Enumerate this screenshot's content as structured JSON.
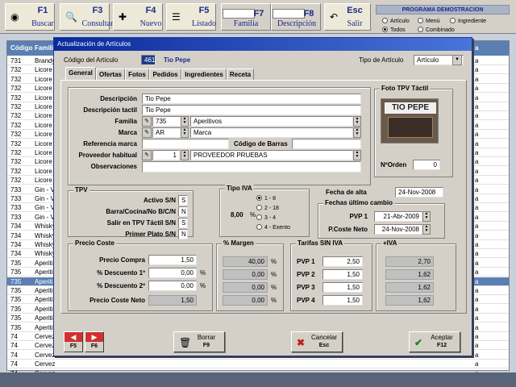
{
  "toolbar": {
    "buttons": [
      {
        "key": "F1",
        "label": "Buscar",
        "icon": "binoculars-icon"
      },
      {
        "key": "F3",
        "label": "Consultar",
        "icon": "magnifier-doc-icon"
      },
      {
        "key": "F4",
        "label": "Nuevo",
        "icon": "new-doc-icon"
      },
      {
        "key": "F5",
        "label": "Listado",
        "icon": "list-icon"
      }
    ],
    "f7": {
      "key": "F7",
      "label": "Familia"
    },
    "f8": {
      "key": "F8",
      "label": "Descripción"
    },
    "esc": {
      "key": "Esc",
      "label": "Salir",
      "icon": "exit-arrow-icon"
    }
  },
  "demo": {
    "title": "PROGRAMA DEMOSTRACION",
    "options": [
      "Artículo",
      "Menú",
      "Ingrediente",
      "Todos",
      "Combinado"
    ],
    "selected": "Todos"
  },
  "grid": {
    "headers": [
      "Código",
      "Familia",
      "a"
    ],
    "rows": [
      {
        "code": "731",
        "fam": "Brandy",
        "end": "a"
      },
      {
        "code": "732",
        "fam": "Licore",
        "end": "a"
      },
      {
        "code": "732",
        "fam": "Licore",
        "end": "a"
      },
      {
        "code": "732",
        "fam": "Licore",
        "end": "a"
      },
      {
        "code": "732",
        "fam": "Licore",
        "end": "a"
      },
      {
        "code": "732",
        "fam": "Licore",
        "end": "a"
      },
      {
        "code": "732",
        "fam": "Licore",
        "end": "a"
      },
      {
        "code": "732",
        "fam": "Licore",
        "end": "a"
      },
      {
        "code": "732",
        "fam": "Licore",
        "end": "a"
      },
      {
        "code": "732",
        "fam": "Licore",
        "end": "a"
      },
      {
        "code": "732",
        "fam": "Licore",
        "end": "a"
      },
      {
        "code": "732",
        "fam": "Licore",
        "end": "a"
      },
      {
        "code": "732",
        "fam": "Licore",
        "end": "a"
      },
      {
        "code": "732",
        "fam": "Licore",
        "end": "a"
      },
      {
        "code": "733",
        "fam": "Gin - V",
        "end": "a"
      },
      {
        "code": "733",
        "fam": "Gin - V",
        "end": "a"
      },
      {
        "code": "733",
        "fam": "Gin - V",
        "end": "a"
      },
      {
        "code": "733",
        "fam": "Gin - V",
        "end": "a"
      },
      {
        "code": "734",
        "fam": "Whisky",
        "end": "a"
      },
      {
        "code": "734",
        "fam": "Whisky",
        "end": "a"
      },
      {
        "code": "734",
        "fam": "Whisky",
        "end": "a"
      },
      {
        "code": "734",
        "fam": "Whisky",
        "end": "a"
      },
      {
        "code": "735",
        "fam": "Aperiti",
        "end": "a"
      },
      {
        "code": "735",
        "fam": "Aperiti",
        "end": "a"
      },
      {
        "code": "735",
        "fam": "Aperiti",
        "end": "a"
      },
      {
        "code": "735",
        "fam": "Aperiti",
        "end": "a"
      },
      {
        "code": "735",
        "fam": "Aperiti",
        "end": "a"
      },
      {
        "code": "735",
        "fam": "Aperiti",
        "end": "a"
      },
      {
        "code": "735",
        "fam": "Aperiti",
        "end": "a"
      },
      {
        "code": "735",
        "fam": "Aperiti",
        "end": "a"
      },
      {
        "code": "74",
        "fam": "Cervez",
        "end": "a"
      },
      {
        "code": "74",
        "fam": "Cervez",
        "end": "a"
      },
      {
        "code": "74",
        "fam": "Cervez",
        "end": "a"
      },
      {
        "code": "74",
        "fam": "Cervez",
        "end": "a"
      },
      {
        "code": "74",
        "fam": "Cervez",
        "end": "a"
      }
    ],
    "selected_index": 24
  },
  "dialog": {
    "title": "Actualización de Artículos",
    "codigo_label": "Código del Artículo",
    "codigo_value": "461",
    "codigo_name": "Tio Pepe",
    "tipo_label": "Tipo de Artículo",
    "tipo_value": "Artículo",
    "tabs": [
      "General",
      "Ofertas",
      "Fotos",
      "Pedidos",
      "Ingredientes",
      "Receta"
    ],
    "active_tab": "General",
    "descripcion_label": "Descripción",
    "descripcion_value": "Tio Pepe",
    "desc_tactil_label": "Descripción tactil",
    "desc_tactil_value": "Tio Pepe",
    "familia_label": "Familia",
    "familia_code": "735",
    "familia_name": "Aperitivos",
    "marca_label": "Marca",
    "marca_code": "AR",
    "marca_name": "Marca",
    "ref_marca_label": "Referencia marca",
    "cod_barras_label": "Código de Barras",
    "proveedor_label": "Proveedor habitual",
    "proveedor_code": "1",
    "proveedor_name": "PROVEEDOR PRUEBAS",
    "observaciones_label": "Observaciones",
    "foto_title": "Foto TPV Táctil",
    "foto_text": "TIO PEPE",
    "norden_label": "NºOrden",
    "norden_value": "0",
    "tpv_title": "TPV",
    "activo_label": "Activo S/N",
    "activo_value": "S",
    "barra_label": "Barra/Cocina/No B/C/N",
    "barra_value": "N",
    "salir_label": "Salir en TPV Táctil S/N",
    "salir_value": "S",
    "primer_label": "Primer Plato S/N",
    "primer_value": "N",
    "iva_title": "Tipo IVA",
    "iva_value": "8,00",
    "iva_pct": "%",
    "iva_options": [
      "1 - 8",
      "2 - 18",
      "3 - 4",
      "4 - Exento"
    ],
    "iva_selected": "1 - 8",
    "fecha_alta_label": "Fecha de alta",
    "fecha_alta_value": "24-Nov-2008",
    "fechas_title": "Fechas último cambio",
    "pvp1_label": "PVP 1",
    "pvp1_date": "21-Abr-2009",
    "pcoste_label": "P.Coste Neto",
    "pcoste_date": "24-Nov-2008",
    "precio_title": "Precio Coste",
    "pcompra_label": "Precio Compra",
    "pcompra_value": "1,50",
    "desc1_label": "% Descuento 1º",
    "desc1_value": "0,00",
    "desc2_label": "% Descuento 2º",
    "desc2_value": "0,00",
    "pcneto_label": "Precio Coste Neto",
    "pcneto_value": "1,50",
    "margen_title": "% Margen",
    "margenes": [
      "40,00",
      "0,00",
      "0,00",
      "0,00"
    ],
    "tarifas_title": "Tarifas SIN IVA",
    "pvp_labels": [
      "PVP 1",
      "PVP 2",
      "PVP 3",
      "PVP 4"
    ],
    "pvp_values": [
      "2,50",
      "1,50",
      "1,50",
      "1,50"
    ],
    "civa_title": "+IVA",
    "civa_values": [
      "2,70",
      "1,62",
      "1,62",
      "1,62"
    ],
    "pct_sign": "%",
    "f5": "F5",
    "f6": "F6",
    "borrar_label": "Borrar",
    "borrar_key": "F9",
    "cancelar_label": "Cancelar",
    "cancelar_key": "Esc",
    "aceptar_label": "Aceptar",
    "aceptar_key": "F12"
  }
}
